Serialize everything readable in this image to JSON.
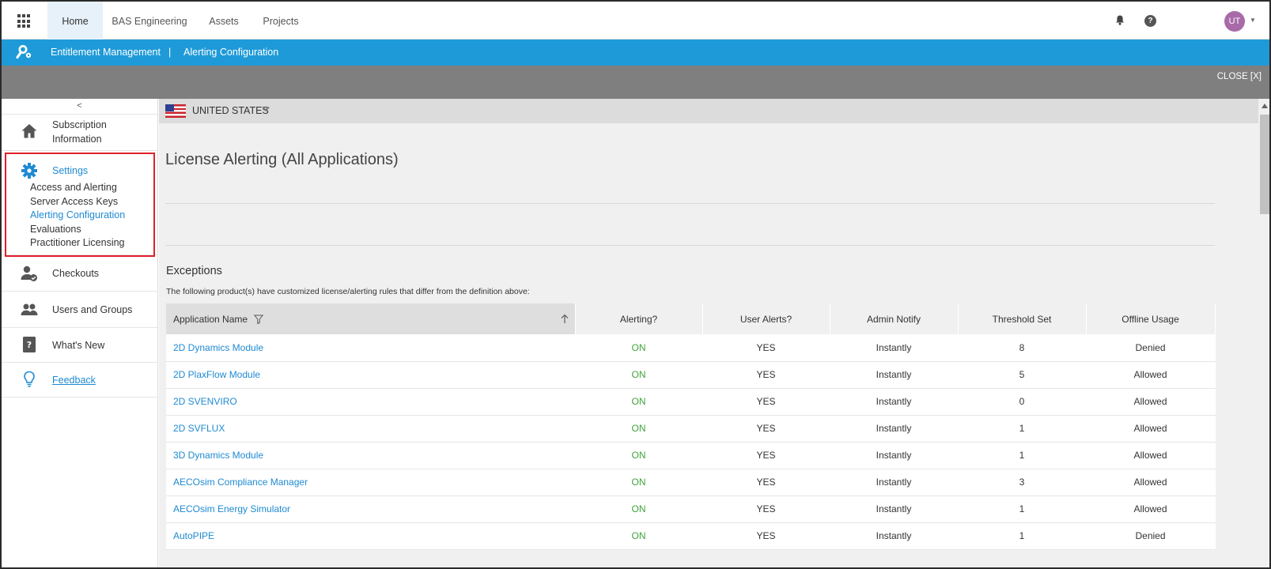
{
  "topnav": {
    "tabs": [
      {
        "label": "Home",
        "active": true
      },
      {
        "label": "BAS Engineering",
        "active": false
      },
      {
        "label": "Assets",
        "active": false
      },
      {
        "label": "Projects",
        "active": false
      }
    ],
    "help_glyph": "?",
    "user_initials": "UT",
    "icons": [
      "app-grid-icon",
      "bell-icon",
      "help-icon",
      "chevron-down-icon"
    ]
  },
  "breadcrumb": {
    "items": [
      "Entitlement Management",
      "Alerting Configuration"
    ],
    "separator": "|",
    "icon": "tools-icon"
  },
  "close_label": "CLOSE [X]",
  "sidebar": {
    "collapse_glyph": "<",
    "items": [
      {
        "label": "Subscription Information",
        "icon": "home-icon"
      },
      {
        "label": "Settings",
        "icon": "gear-icon"
      },
      {
        "label": "Checkouts",
        "icon": "user-check-icon"
      },
      {
        "label": "Users and Groups",
        "icon": "users-icon"
      },
      {
        "label": "What's New",
        "icon": "question-book-icon"
      },
      {
        "label": "Feedback",
        "icon": "lightbulb-icon"
      }
    ],
    "settings_sub": [
      {
        "label": "Access and Alerting",
        "active": false
      },
      {
        "label": "Server Access Keys",
        "active": false
      },
      {
        "label": "Alerting Configuration",
        "active": true
      },
      {
        "label": "Evaluations",
        "active": false
      },
      {
        "label": "Practitioner Licensing",
        "active": false
      }
    ]
  },
  "country": {
    "label": "UNITED STATES",
    "flag": "us-flag-icon"
  },
  "main": {
    "title": "License Alerting (All Applications)",
    "exceptions_title": "Exceptions",
    "exceptions_desc": "The following product(s) have customized license/alerting rules that differ from the definition above:"
  },
  "table": {
    "headers": [
      "Application Name",
      "Alerting?",
      "User Alerts?",
      "Admin Notify",
      "Threshold Set",
      "Offline Usage"
    ],
    "rows": [
      [
        "2D Dynamics Module",
        "ON",
        "YES",
        "Instantly",
        "8",
        "Denied"
      ],
      [
        "2D PlaxFlow Module",
        "ON",
        "YES",
        "Instantly",
        "5",
        "Allowed"
      ],
      [
        "2D SVENVIRO",
        "ON",
        "YES",
        "Instantly",
        "0",
        "Allowed"
      ],
      [
        "2D SVFLUX",
        "ON",
        "YES",
        "Instantly",
        "1",
        "Allowed"
      ],
      [
        "3D Dynamics Module",
        "ON",
        "YES",
        "Instantly",
        "1",
        "Allowed"
      ],
      [
        "AECOsim Compliance Manager",
        "ON",
        "YES",
        "Instantly",
        "3",
        "Allowed"
      ],
      [
        "AECOsim Energy Simulator",
        "ON",
        "YES",
        "Instantly",
        "1",
        "Allowed"
      ],
      [
        "AutoPIPE",
        "ON",
        "YES",
        "Instantly",
        "1",
        "Denied"
      ]
    ]
  },
  "colors": {
    "accent_blue": "#1f9ad8",
    "link_blue": "#1f8ad2",
    "on_green": "#3fa43a",
    "highlight_red": "#e0202a",
    "avatar_purple": "#a96aa8"
  }
}
